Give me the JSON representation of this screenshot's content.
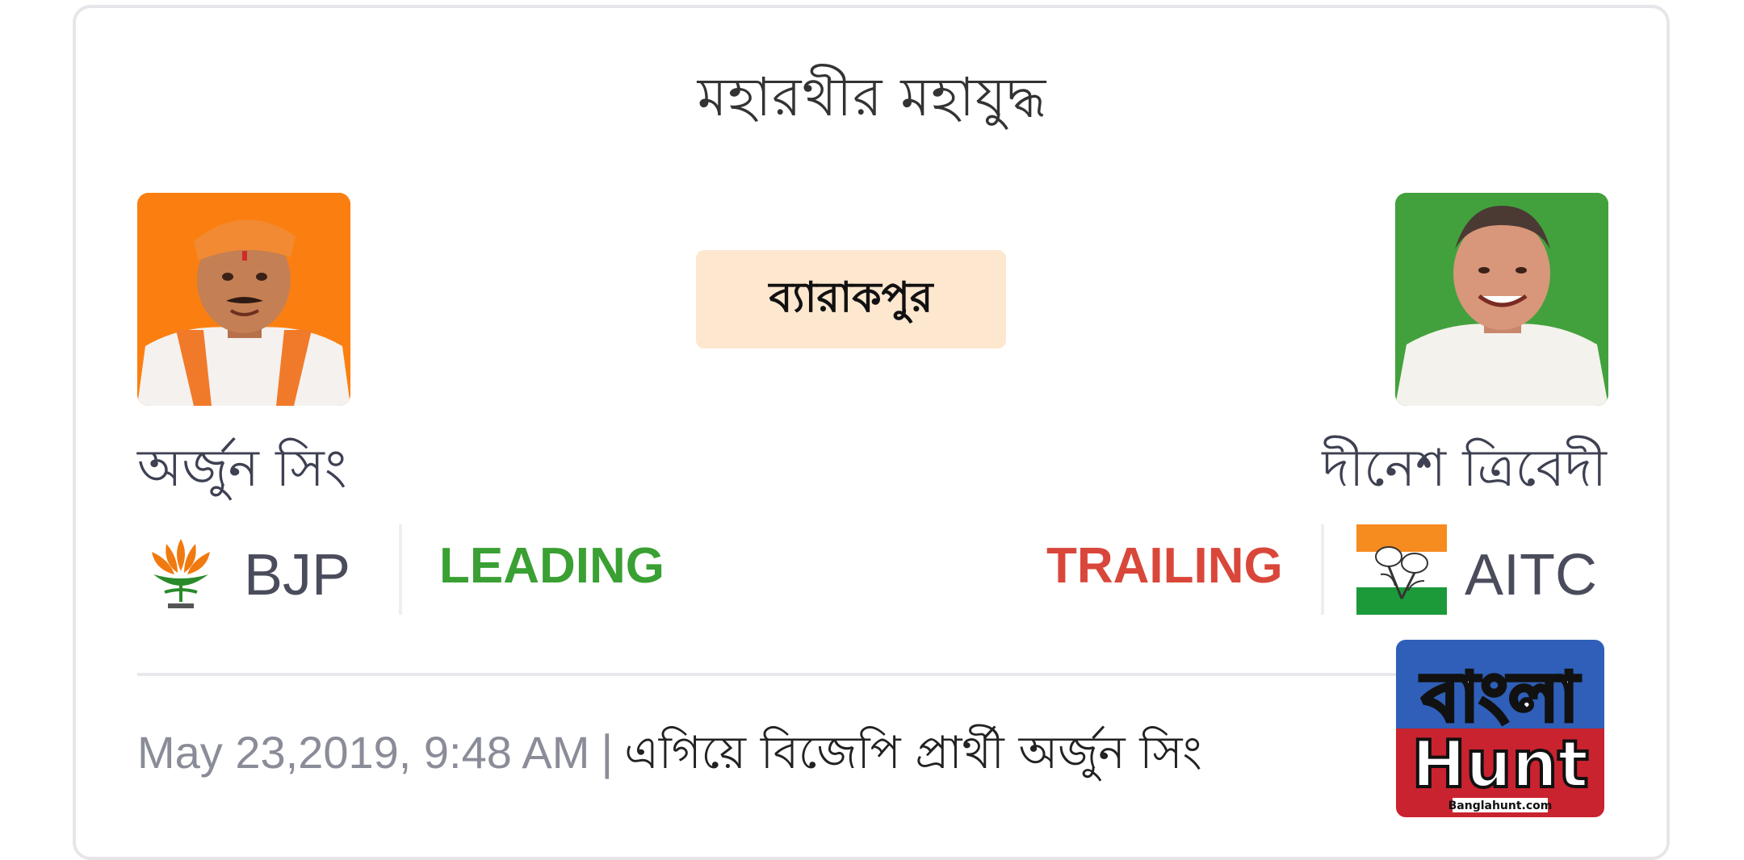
{
  "card": {
    "title": "মহারথীর মহাযুদ্ধ",
    "constituency": "ব্যারাকপুর"
  },
  "candidates": {
    "left": {
      "name": "অর্জুন সিং",
      "party": "BJP",
      "status": "LEADING",
      "photo_bg": "#fb7f10",
      "status_color": "#3aa033"
    },
    "right": {
      "name": "দীনেশ ত্রিবেদী",
      "party": "AITC",
      "status": "TRAILING",
      "photo_bg": "#42a13d",
      "status_color": "#d9473a"
    }
  },
  "update": {
    "timestamp": "May 23,2019, 9:48 AM",
    "separator": "|",
    "headline": "এগিয়ে বিজেপি প্রার্থী অর্জুন সিং"
  },
  "watermark": {
    "brand": "বাংলা",
    "brand_sub": "Hunt",
    "url": "Banglahunt.com"
  },
  "icons": {
    "bjp_logo": "lotus-icon",
    "aitc_logo": "flower-icon"
  }
}
